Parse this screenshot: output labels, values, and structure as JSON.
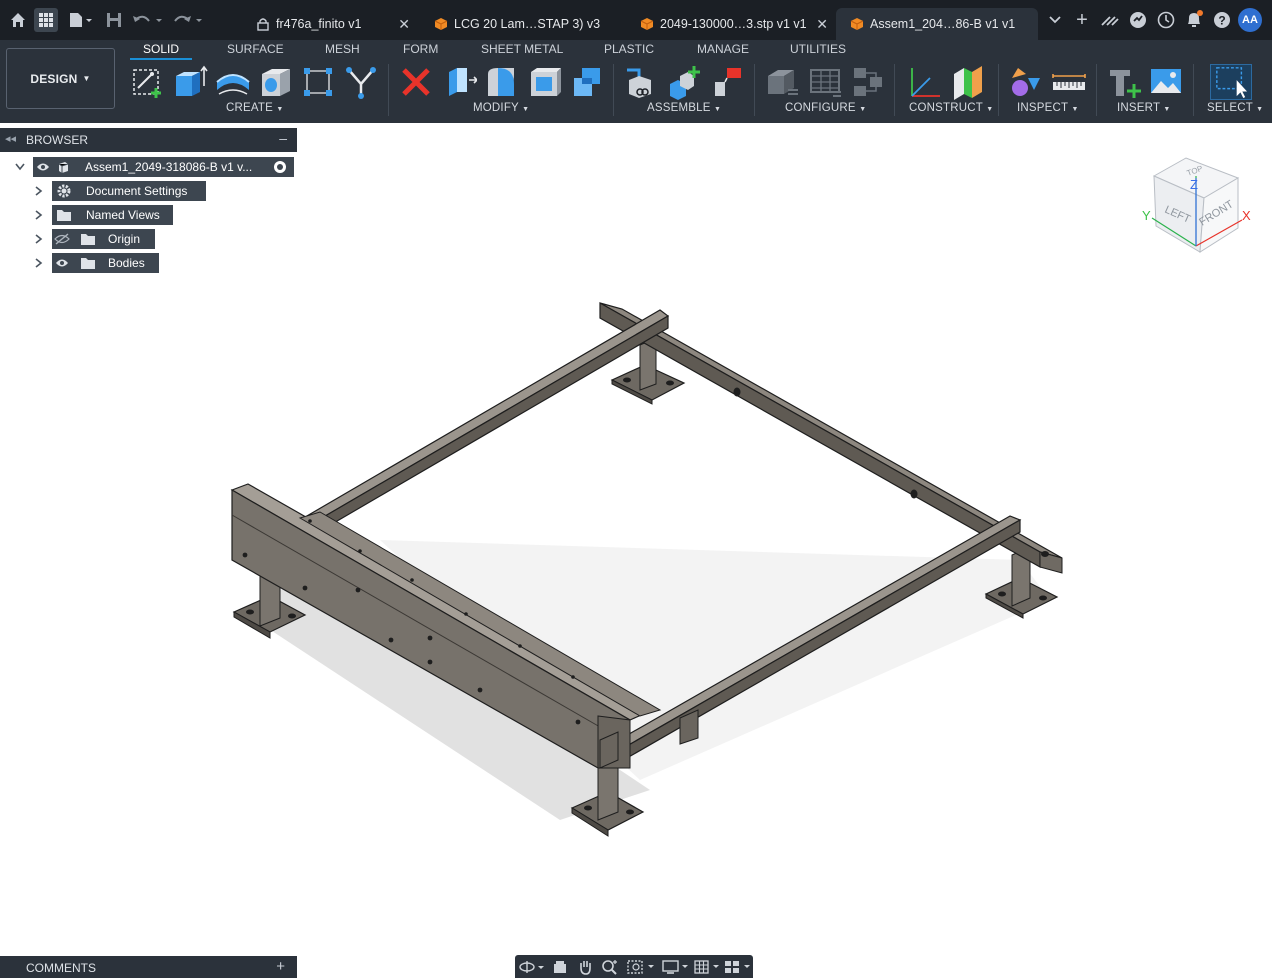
{
  "tabs": [
    {
      "label": "fr476a_finito v1",
      "locked": true,
      "active": false
    },
    {
      "label": "LCG 20 Lam…STAP 3) v3",
      "locked": false,
      "active": false
    },
    {
      "label": "2049-130000…3.stp v1 v1",
      "locked": false,
      "active": false
    },
    {
      "label": "Assem1_204…86-B v1 v1",
      "locked": false,
      "active": true
    }
  ],
  "user_initials": "AA",
  "colors": {
    "accent": "#1a8fd6",
    "toolbar_bg": "#2b323b",
    "titlebar_bg": "#1b1f25",
    "notification": "#f2792b"
  },
  "workspace": {
    "mode_label": "DESIGN",
    "tabs": [
      "SOLID",
      "SURFACE",
      "MESH",
      "FORM",
      "SHEET METAL",
      "PLASTIC",
      "MANAGE",
      "UTILITIES"
    ],
    "active_tab": "SOLID"
  },
  "toolbar_groups": {
    "create": "CREATE",
    "modify": "MODIFY",
    "assemble": "ASSEMBLE",
    "configure": "CONFIGURE",
    "construct": "CONSTRUCT",
    "inspect": "INSPECT",
    "insert": "INSERT",
    "select": "SELECT"
  },
  "browser": {
    "title": "BROWSER",
    "root": "Assem1_2049-318086-B v1 v...",
    "items": [
      {
        "label": "Document Settings",
        "icon": "gear-icon"
      },
      {
        "label": "Named Views",
        "icon": "folder-icon"
      },
      {
        "label": "Origin",
        "icon": "folder-icon",
        "hidden": true
      },
      {
        "label": "Bodies",
        "icon": "folder-icon"
      }
    ]
  },
  "comments": {
    "title": "COMMENTS"
  },
  "viewcube": {
    "top": "TOP",
    "left": "LEFT",
    "front": "FRONT",
    "axis_x": "X",
    "axis_y": "Y",
    "axis_z": "Z"
  }
}
